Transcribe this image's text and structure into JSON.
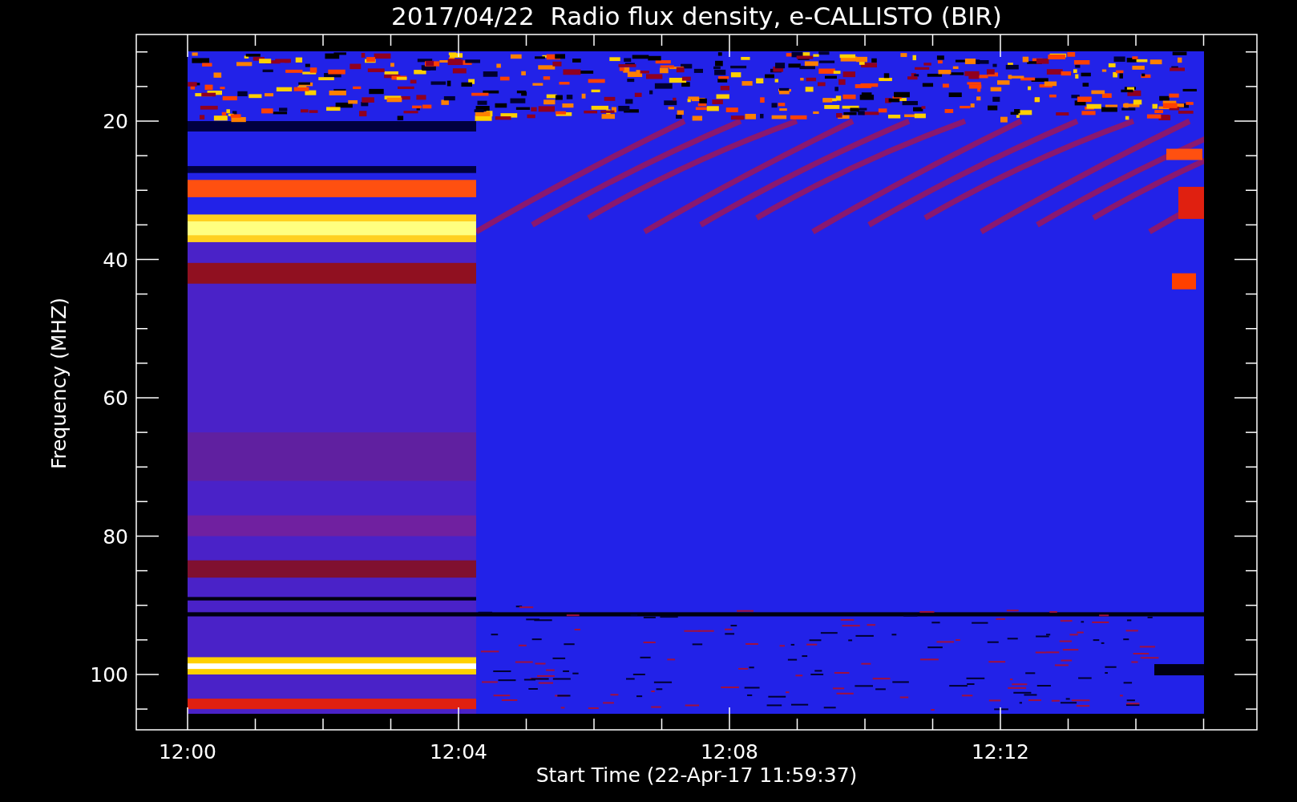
{
  "title": "2017/04/22  Radio flux density, e-CALLISTO (BIR)",
  "y_axis": {
    "label": "Frequency (MHZ)",
    "ticks": [
      "20",
      "40",
      "60",
      "80",
      "100"
    ]
  },
  "x_axis": {
    "label": "Start Time (22-Apr-17 11:59:37)",
    "ticks": [
      "12:00",
      "12:04",
      "12:08",
      "12:12"
    ]
  }
}
